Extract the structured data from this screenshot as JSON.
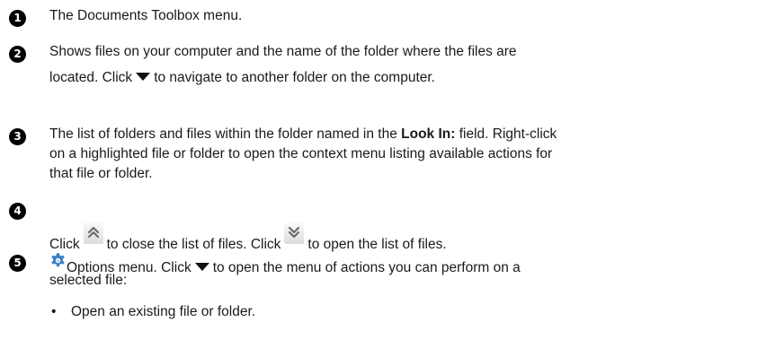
{
  "items": [
    {
      "number": "1",
      "lines": [
        "The Documents Toolbox menu."
      ]
    },
    {
      "number": "2",
      "lines": [
        "Shows files on your computer and the name of the folder where the files are",
        "located. Click",
        "to navigate to another folder on the computer."
      ]
    },
    {
      "number": "3",
      "line1_a": "The list of folders and files within the folder named in the ",
      "line1_bold": "Look In:",
      "line1_b": " field. Right-click",
      "line2": "on a highlighted file or folder to open the context menu listing available actions for",
      "line3": "that file or folder."
    },
    {
      "number": "4",
      "click1": "Click",
      "close_text": "to close the list of files. Click",
      "open_text": "to open the list of files."
    },
    {
      "number": "5",
      "line1_a": "Options menu. Click",
      "line1_b": "to open the menu of actions you can perform on a",
      "line2": "selected file:",
      "bullet_char": "•",
      "bullet1": "Open an existing file or folder."
    }
  ],
  "icons": {
    "dropdown": "dropdown-arrow-icon",
    "collapse": "collapse-double-chevron-icon",
    "expand": "expand-double-chevron-icon",
    "options": "options-gear-icon"
  },
  "colors": {
    "text": "#1a1a1a",
    "badge": "#000000",
    "gear_blue": "#3b7fc4"
  }
}
